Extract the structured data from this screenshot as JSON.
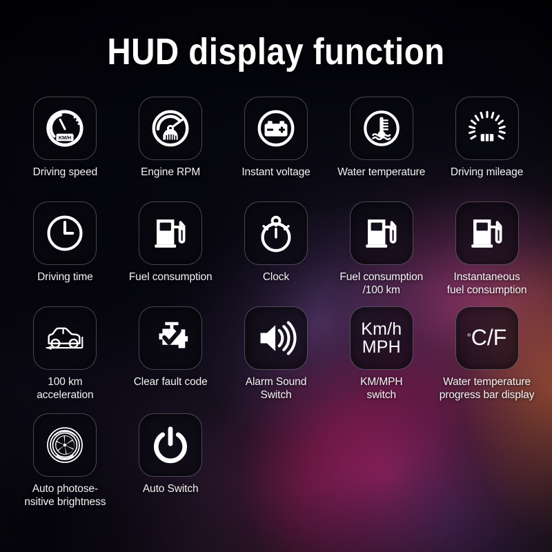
{
  "page": {
    "title": "HUD display function",
    "background_colors": {
      "base_dark": "#0a0a14",
      "magenta_glow": "#b21e60",
      "warm_glow": "#ba5c3e",
      "violet_glow": "#6e488c",
      "indigo_glow": "#3a3068"
    },
    "icon_color": "#ffffff",
    "text_color": "#f4f4f6"
  },
  "features": [
    [
      {
        "id": "driving-speed",
        "label": "Driving speed",
        "icon": "speedometer-icon",
        "tile_text": null
      },
      {
        "id": "engine-rpm",
        "label": "Engine RPM",
        "icon": "tachometer-icon",
        "tile_text": null
      },
      {
        "id": "instant-voltage",
        "label": "Instant voltage",
        "icon": "battery-icon",
        "tile_text": null
      },
      {
        "id": "water-temperature",
        "label": "Water temperature",
        "icon": "coolant-temp-icon",
        "tile_text": null
      },
      {
        "id": "driving-mileage",
        "label": "Driving mileage",
        "icon": "odometer-icon",
        "tile_text": null
      }
    ],
    [
      {
        "id": "driving-time",
        "label": "Driving time",
        "icon": "clock-icon",
        "tile_text": null
      },
      {
        "id": "fuel-consumption",
        "label": "Fuel consumption",
        "icon": "fuel-pump-icon",
        "tile_text": null
      },
      {
        "id": "clock",
        "label": "Clock",
        "icon": "stopwatch-icon",
        "tile_text": null
      },
      {
        "id": "fuel-per-100km",
        "label": "Fuel consumption\n/100 km",
        "icon": "fuel-pump-icon",
        "tile_text": null
      },
      {
        "id": "instant-fuel",
        "label": "Instantaneous\nfuel consumption",
        "icon": "fuel-pump-icon",
        "tile_text": null
      }
    ],
    [
      {
        "id": "acceleration-100km",
        "label": "100 km\nacceleration",
        "icon": "car-acceleration-icon",
        "tile_text": null
      },
      {
        "id": "clear-fault-code",
        "label": "Clear fault code",
        "icon": "engine-check-icon",
        "tile_text": null
      },
      {
        "id": "alarm-sound-switch",
        "label": "Alarm Sound\nSwitch",
        "icon": "speaker-icon",
        "tile_text": null
      },
      {
        "id": "km-mph-switch",
        "label": "KM/MPH\nswitch",
        "icon": "text-icon",
        "tile_text": "Km/h\nMPH"
      },
      {
        "id": "water-temp-bar",
        "label": "Water temperature\nprogress bar display",
        "icon": "text-icon",
        "tile_text": "°C/F"
      }
    ],
    [
      {
        "id": "auto-brightness",
        "label": "Auto photose-\nnsitive brightness",
        "icon": "aperture-icon",
        "tile_text": null
      },
      {
        "id": "auto-switch",
        "label": "Auto Switch",
        "icon": "power-icon",
        "tile_text": null
      }
    ]
  ],
  "tile_texts": {
    "km_mph_line1": "Km/h",
    "km_mph_line2": "MPH",
    "degree_symbol": "°",
    "cf_text": "C/F"
  },
  "icon_labels": {
    "speedometer": "KM/H"
  }
}
